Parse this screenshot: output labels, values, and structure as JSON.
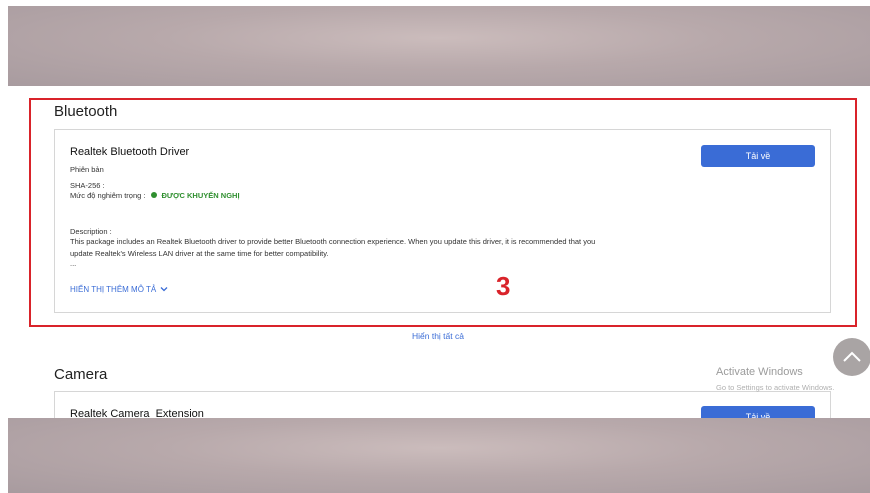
{
  "bluetooth": {
    "section_title": "Bluetooth",
    "driver": {
      "name": "Realtek Bluetooth Driver",
      "version_label": "Phiên bản",
      "sha_label": "SHA-256 :",
      "severity_label": "Mức độ nghiêm trọng :",
      "severity_value": "ĐƯỢC KHUYẾN NGHỊ",
      "description_label": "Description :",
      "description_line1": "This package includes an Realtek Bluetooth driver to provide better Bluetooth connection experience. When you update this driver, it is recommended that you",
      "description_line2": "update Realtek's Wireless LAN driver at the same time for better compatibility.",
      "description_ellipsis": "...",
      "show_more": "HIỂN THỊ THÊM MÔ TẢ",
      "download_label": "Tải về"
    }
  },
  "show_all": "Hiển thị tất cả",
  "annotation_number": "3",
  "camera": {
    "section_title": "Camera",
    "driver": {
      "name": "Realtek Camera_Extension",
      "download_label": "Tải về"
    }
  },
  "watermark": {
    "title": "Activate Windows",
    "subtitle": "Go to Settings to activate Windows."
  },
  "colors": {
    "accent": "#3a6cd6",
    "annotation": "#d9232a",
    "recommended": "#2f8f2f"
  },
  "icons": {
    "show_more": "chevron-down-icon",
    "scroll": "chevron-up-icon",
    "severity": "status-dot-icon"
  }
}
